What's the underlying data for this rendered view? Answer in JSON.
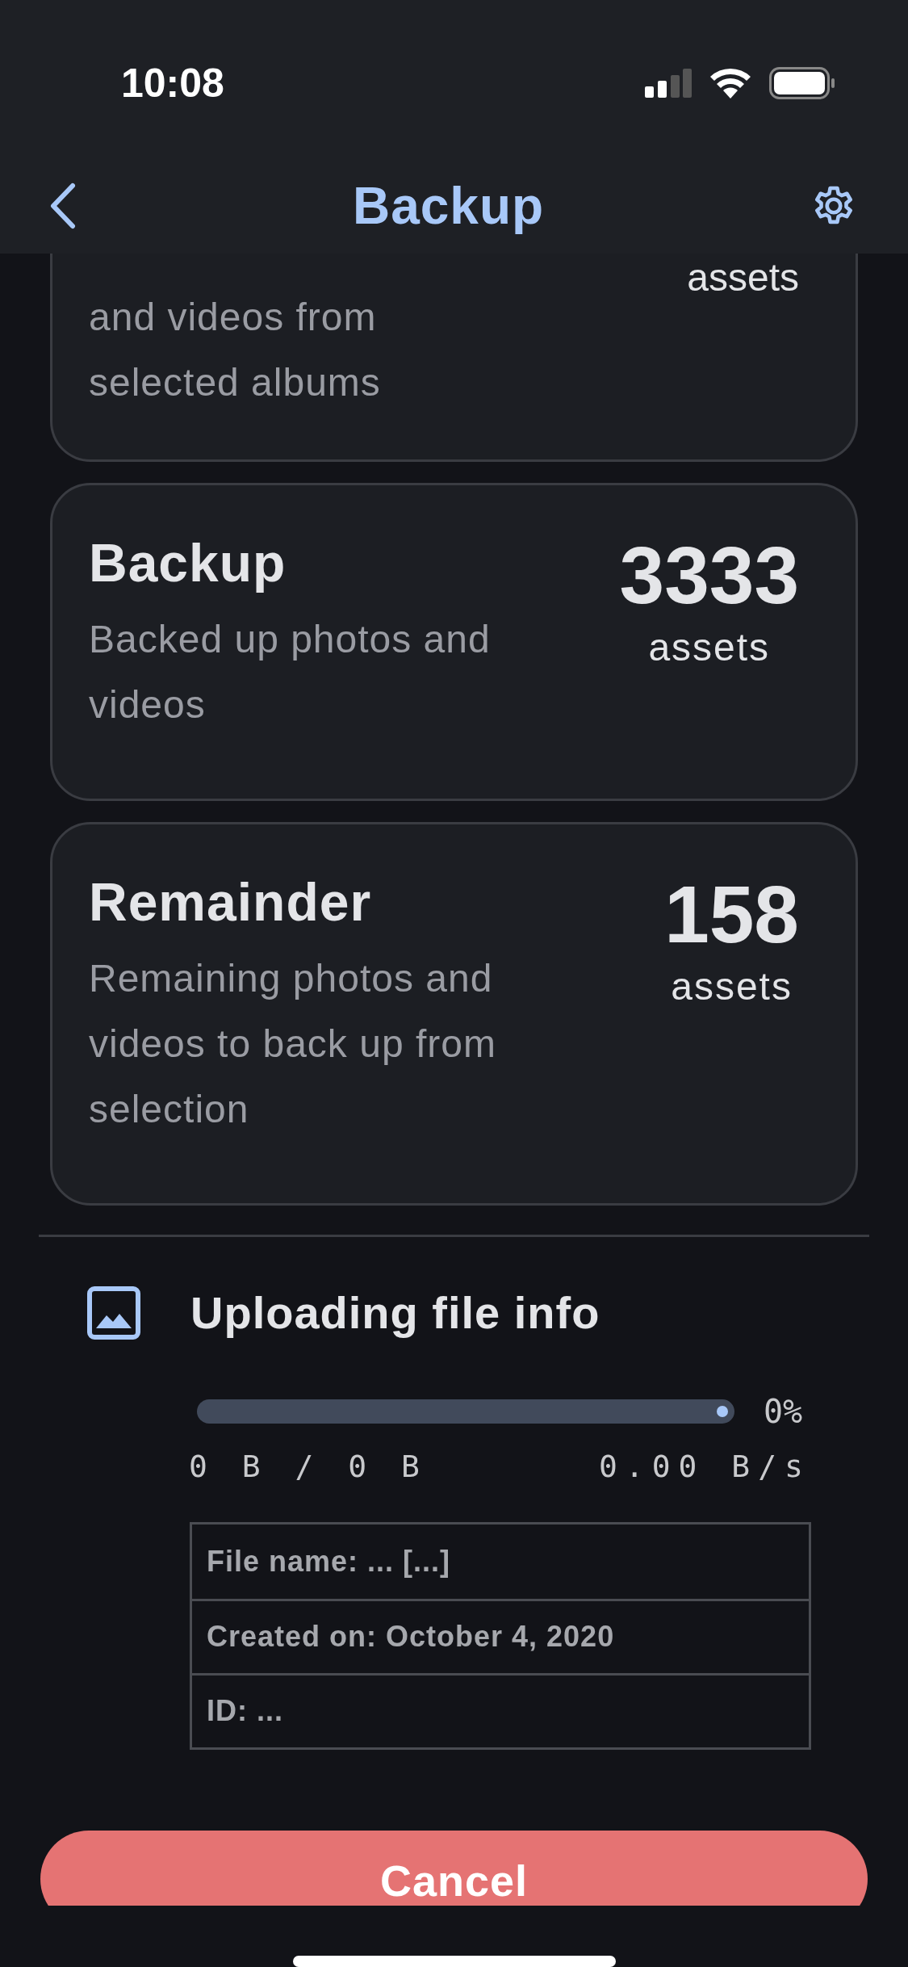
{
  "status_bar": {
    "time": "10:08"
  },
  "header": {
    "title": "Backup"
  },
  "cards": [
    {
      "kind": "cut",
      "description": "and videos from selected albums",
      "unit": "assets"
    },
    {
      "kind": "full",
      "title": "Backup",
      "description": "Backed up photos and videos",
      "count": "3333",
      "unit": "assets"
    },
    {
      "kind": "full",
      "title": "Remainder",
      "description": "Remaining photos and videos to back up from selection",
      "count": "158",
      "unit": "assets"
    }
  ],
  "upload": {
    "title": "Uploading file info",
    "progress": {
      "level": 0,
      "percent": "0%"
    },
    "transferred": "0 B / 0 B",
    "speed": "0.00 B/s",
    "info_rows": [
      "File name: ... [...]",
      "Created on: October 4, 2020",
      "ID: ..."
    ]
  },
  "cancel_button": "Cancel"
}
